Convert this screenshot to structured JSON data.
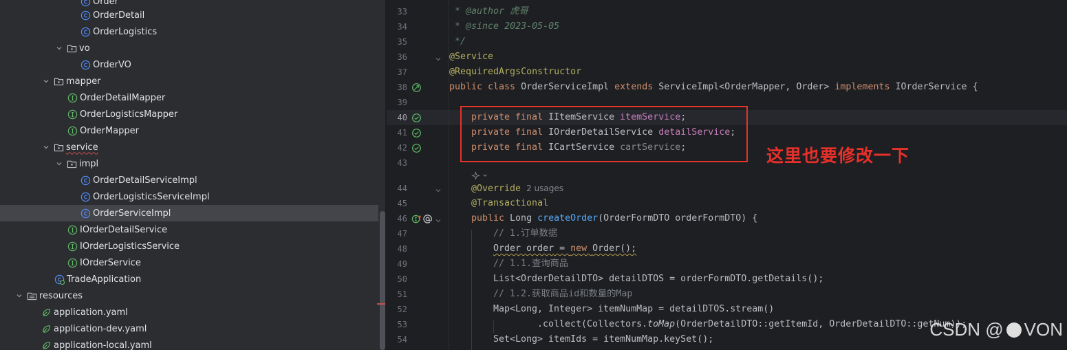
{
  "tree": {
    "items": [
      {
        "label": "Order",
        "type": "class"
      },
      {
        "label": "OrderDetail",
        "type": "class"
      },
      {
        "label": "OrderLogistics",
        "type": "class"
      },
      {
        "label": "vo",
        "type": "package"
      },
      {
        "label": "OrderVO",
        "type": "class"
      },
      {
        "label": "mapper",
        "type": "package"
      },
      {
        "label": "OrderDetailMapper",
        "type": "interface"
      },
      {
        "label": "OrderLogisticsMapper",
        "type": "interface"
      },
      {
        "label": "OrderMapper",
        "type": "interface"
      },
      {
        "label": "service",
        "type": "package"
      },
      {
        "label": "impl",
        "type": "package"
      },
      {
        "label": "OrderDetailServiceImpl",
        "type": "class"
      },
      {
        "label": "OrderLogisticsServiceImpl",
        "type": "class"
      },
      {
        "label": "OrderServiceImpl",
        "type": "class",
        "selected": true
      },
      {
        "label": "IOrderDetailService",
        "type": "interface"
      },
      {
        "label": "IOrderLogisticsService",
        "type": "interface"
      },
      {
        "label": "IOrderService",
        "type": "interface"
      },
      {
        "label": "TradeApplication",
        "type": "spring-app"
      },
      {
        "label": "resources",
        "type": "folder"
      },
      {
        "label": "application.yaml",
        "type": "yaml"
      },
      {
        "label": "application-dev.yaml",
        "type": "yaml"
      },
      {
        "label": "application-local.yaml",
        "type": "yaml"
      }
    ]
  },
  "editor": {
    "line_numbers": [
      "33",
      "34",
      "35",
      "36",
      "37",
      "38",
      "39",
      "40",
      "41",
      "42",
      "43",
      "44",
      "45",
      "46",
      "47",
      "48",
      "49",
      "50",
      "51",
      "52",
      "53",
      "54"
    ],
    "current_line": "40",
    "code": {
      "l33_star": " * ",
      "l33_tag": "@author",
      "l33_val": " 虎哥",
      "l34_star": " * ",
      "l34_tag": "@since",
      "l34_val": " 2023-05-05",
      "l35": " */",
      "l36": "@Service",
      "l37": "@RequiredArgsConstructor",
      "l38_public": "public class ",
      "l38_name": "OrderServiceImpl ",
      "l38_extends": "extends ",
      "l38_super": "ServiceImpl<OrderMapper, Order> ",
      "l38_impl": "implements ",
      "l38_iface": "IOrderService {",
      "l40_kw": "private final ",
      "l40_type": "IItemService ",
      "l40_field": "itemService",
      "l40_end": ";",
      "l41_kw": "private final ",
      "l41_type": "IOrderDetailService ",
      "l41_field": "detailService",
      "l41_end": ";",
      "l42_kw": "private final ",
      "l42_type": "ICartService ",
      "l42_field": "cartService",
      "l42_end": ";",
      "l44_ann": "@Override",
      "l44_usages": "2 usages",
      "l45": "@Transactional",
      "l46_kw": "public ",
      "l46_type": "Long ",
      "l46_method": "createOrder",
      "l46_rest": "(OrderFormDTO orderFormDTO) {",
      "l47": "// 1.订单数据",
      "l48_a": "Order ",
      "l48_var": "order",
      "l48_b": " = ",
      "l48_new": "new ",
      "l48_c": "Order();",
      "l49": "// 1.1.查询商品",
      "l50": "List<OrderDetailDTO> detailDTOS = orderFormDTO.getDetails();",
      "l51": "// 1.2.获取商品id和数量的Map",
      "l52": "Map<Long, Integer> itemNumMap = detailDTOS.stream()",
      "l53_a": ".collect(Collectors.",
      "l53_m": "toMap",
      "l53_b": "(OrderDetailDTO::getItemId, OrderDetailDTO::getNum));",
      "l54": "Set<Long> itemIds = itemNumMap.keySet();"
    }
  },
  "annotation": {
    "note": "这里也要修改一下",
    "box_color": "#e5332a"
  },
  "watermark": {
    "prefix": "CSDN @",
    "suffix": "VON"
  }
}
